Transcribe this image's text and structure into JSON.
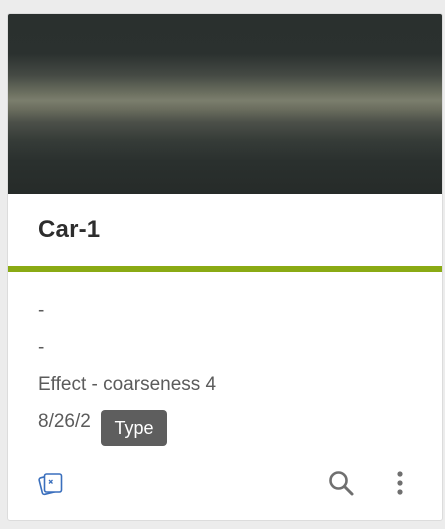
{
  "card": {
    "title": "Car-1",
    "accent_color": "#8aaa14",
    "details": [
      "-",
      "-",
      "Effect - coarseness 4",
      "8/26/2"
    ]
  },
  "tooltip": {
    "text": "Type"
  },
  "footer": {
    "type_icon": "type-icon",
    "search_icon": "search-icon",
    "more_icon": "more-vertical-icon"
  }
}
